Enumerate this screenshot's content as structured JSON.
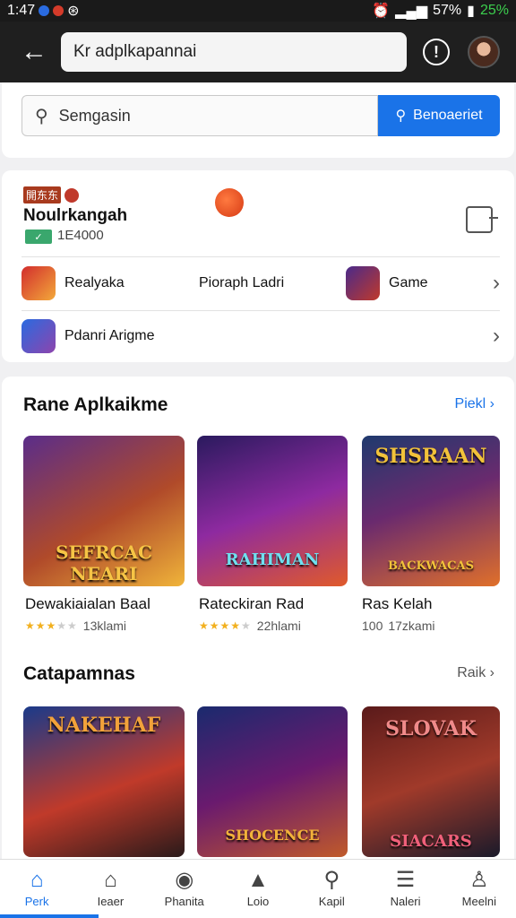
{
  "status_bar": {
    "time": "1:47",
    "battery_pct": "57%",
    "battery_text": "25%"
  },
  "app_bar": {
    "search_text": "Kr adplkapannai"
  },
  "search": {
    "placeholder": "Semgasin",
    "button_label": "Benoaeriet"
  },
  "developer": {
    "logo_text": "開东东",
    "name": "Noulrkangah",
    "count": "1E4000"
  },
  "rows": [
    {
      "label": "Realyaka"
    },
    {
      "label": "Pioraph Ladri"
    },
    {
      "label": "Game"
    },
    {
      "label": "Pdanri Arigme"
    }
  ],
  "section1": {
    "title": "Rane Aplkaikme",
    "more": "Piekl",
    "games": [
      {
        "art_title": "SEFRCAC NEARI",
        "name": "Dewakiaialan Baal",
        "rating": 3,
        "meta": "13klami"
      },
      {
        "art_title": "RAHIMAN",
        "name": "Rateckiran Rad",
        "rating": 4,
        "meta": "22hlami"
      },
      {
        "art_title": "SHSRAAN",
        "name": "Ras Kelah",
        "rating_text": "100",
        "meta": "17zkami",
        "art_sub": "BACKWACAS"
      }
    ]
  },
  "section2": {
    "title": "Catapamnas",
    "more": "Raik",
    "games": [
      {
        "art_title": "NAKEHAF"
      },
      {
        "art_title": "SHOCENCE"
      },
      {
        "art_title": "SLOVAK",
        "art_sub": "SIACARS"
      }
    ]
  },
  "bottom_nav": [
    {
      "label": "Perk",
      "icon": "home-icon",
      "active": true
    },
    {
      "label": "Ieaer",
      "icon": "apps-icon"
    },
    {
      "label": "Phanita",
      "icon": "person-icon"
    },
    {
      "label": "Loio",
      "icon": "upload-icon"
    },
    {
      "label": "Kapil",
      "icon": "search-icon"
    },
    {
      "label": "Naleri",
      "icon": "list-icon"
    },
    {
      "label": "Meelni",
      "icon": "account-icon"
    }
  ],
  "colors": {
    "accent": "#1a73e8",
    "app_bar": "#1f1f1f",
    "star": "#f2b01e"
  }
}
